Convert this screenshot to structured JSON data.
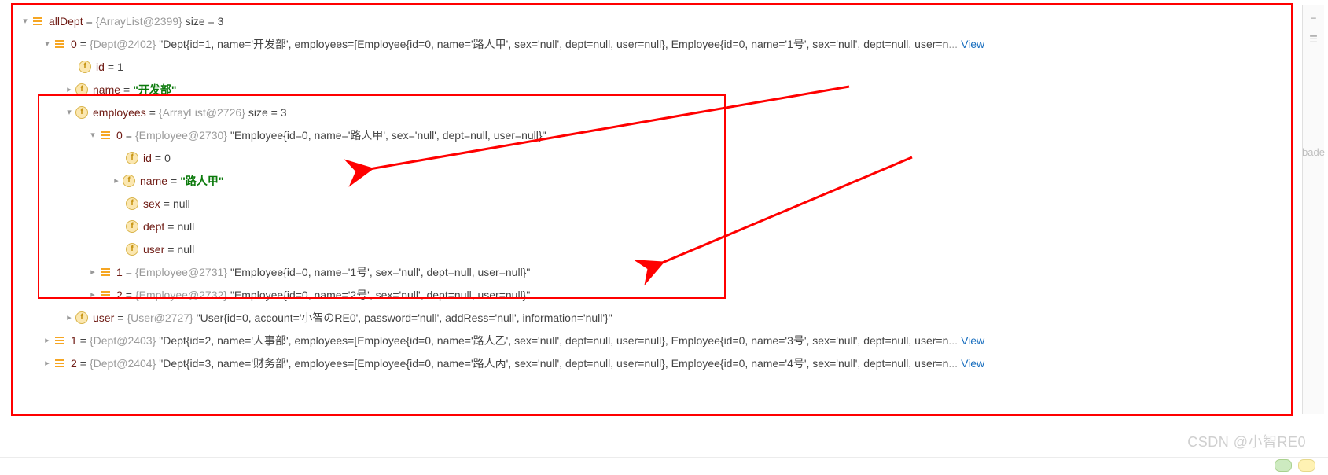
{
  "root": {
    "name": "allDept",
    "ref": "{ArrayList@2399}",
    "size_label": "size = 3"
  },
  "dept0": {
    "idx": "0",
    "ref": "{Dept@2402}",
    "str": "\"Dept{id=1, name='开发部', employees=[Employee{id=0, name='路人甲', sex='null', dept=null, user=null}, Employee{id=0, name='1号', sex='null', dept=null, user=n",
    "view": "View",
    "id_label": "id",
    "id_val": "1",
    "name_label": "name",
    "name_val": "\"开发部\""
  },
  "employees": {
    "label": "employees",
    "ref": "{ArrayList@2726}",
    "size_label": "size = 3"
  },
  "emp0": {
    "idx": "0",
    "ref": "{Employee@2730}",
    "str": "\"Employee{id=0, name='路人甲', sex='null', dept=null, user=null}\"",
    "id_label": "id",
    "id_val": "0",
    "name_label": "name",
    "name_val": "\"路人甲\"",
    "sex_label": "sex",
    "sex_val": "null",
    "dept_label": "dept",
    "dept_val": "null",
    "user_label": "user",
    "user_val": "null"
  },
  "emp1": {
    "idx": "1",
    "ref": "{Employee@2731}",
    "str": "\"Employee{id=0, name='1号', sex='null', dept=null, user=null}\""
  },
  "emp2": {
    "idx": "2",
    "ref": "{Employee@2732}",
    "str": "\"Employee{id=0, name='2号', sex='null', dept=null, user=null}\""
  },
  "user_field": {
    "label": "user",
    "ref": "{User@2727}",
    "str": "\"User{id=0, account='小智のRE0', password='null', addRess='null', information='null'}\""
  },
  "dept1": {
    "idx": "1",
    "ref": "{Dept@2403}",
    "str": "\"Dept{id=2, name='人事部', employees=[Employee{id=0, name='路人乙', sex='null', dept=null, user=null}, Employee{id=0, name='3号', sex='null', dept=null, user=n",
    "view": "View"
  },
  "dept2": {
    "idx": "2",
    "ref": "{Dept@2404}",
    "str": "\"Dept{id=3, name='财务部', employees=[Employee{id=0, name='路人丙', sex='null', dept=null, user=null}, Employee{id=0, name='4号', sex='null', dept=null, user=n",
    "view": "View"
  },
  "side_text": "bade",
  "watermark": "CSDN @小智RE0",
  "ellipsis": "..."
}
